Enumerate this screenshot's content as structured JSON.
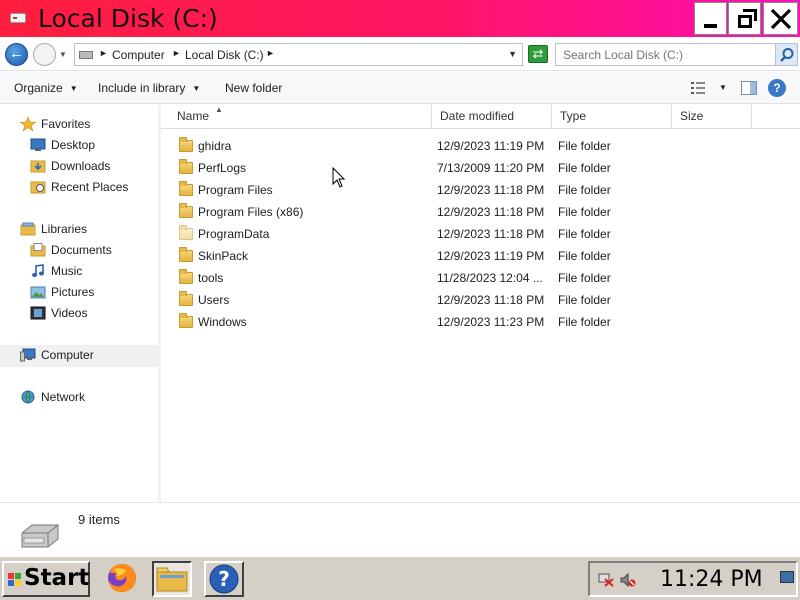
{
  "window": {
    "title": "Local Disk (C:)"
  },
  "address": {
    "crumbs": [
      "Computer",
      "Local Disk (C:)"
    ],
    "search_placeholder": "Search Local Disk (C:)"
  },
  "toolbar": {
    "organize": "Organize",
    "include_in_library": "Include in library",
    "new_folder": "New folder"
  },
  "nav": {
    "favorites": "Favorites",
    "desktop": "Desktop",
    "downloads": "Downloads",
    "recent_places": "Recent Places",
    "libraries": "Libraries",
    "documents": "Documents",
    "music": "Music",
    "pictures": "Pictures",
    "videos": "Videos",
    "computer": "Computer",
    "network": "Network"
  },
  "columns": {
    "name": "Name",
    "date_modified": "Date modified",
    "type": "Type",
    "size": "Size"
  },
  "files": [
    {
      "name": "ghidra",
      "date": "12/9/2023 11:19 PM",
      "type": "File folder",
      "size": ""
    },
    {
      "name": "PerfLogs",
      "date": "7/13/2009 11:20 PM",
      "type": "File folder",
      "size": ""
    },
    {
      "name": "Program Files",
      "date": "12/9/2023 11:18 PM",
      "type": "File folder",
      "size": ""
    },
    {
      "name": "Program Files (x86)",
      "date": "12/9/2023 11:18 PM",
      "type": "File folder",
      "size": ""
    },
    {
      "name": "ProgramData",
      "date": "12/9/2023 11:18 PM",
      "type": "File folder",
      "size": ""
    },
    {
      "name": "SkinPack",
      "date": "12/9/2023 11:19 PM",
      "type": "File folder",
      "size": ""
    },
    {
      "name": "tools",
      "date": "11/28/2023 12:04 ...",
      "type": "File folder",
      "size": ""
    },
    {
      "name": "Users",
      "date": "12/9/2023 11:18 PM",
      "type": "File folder",
      "size": ""
    },
    {
      "name": "Windows",
      "date": "12/9/2023 11:23 PM",
      "type": "File folder",
      "size": ""
    }
  ],
  "details": {
    "item_count": "9 items"
  },
  "taskbar": {
    "start_label": "Start",
    "clock": "11:24 PM"
  },
  "colors": {
    "titlebar_gradient": [
      "#ff1e3c",
      "#ff0fb4"
    ],
    "folder": "#e8bb48"
  }
}
